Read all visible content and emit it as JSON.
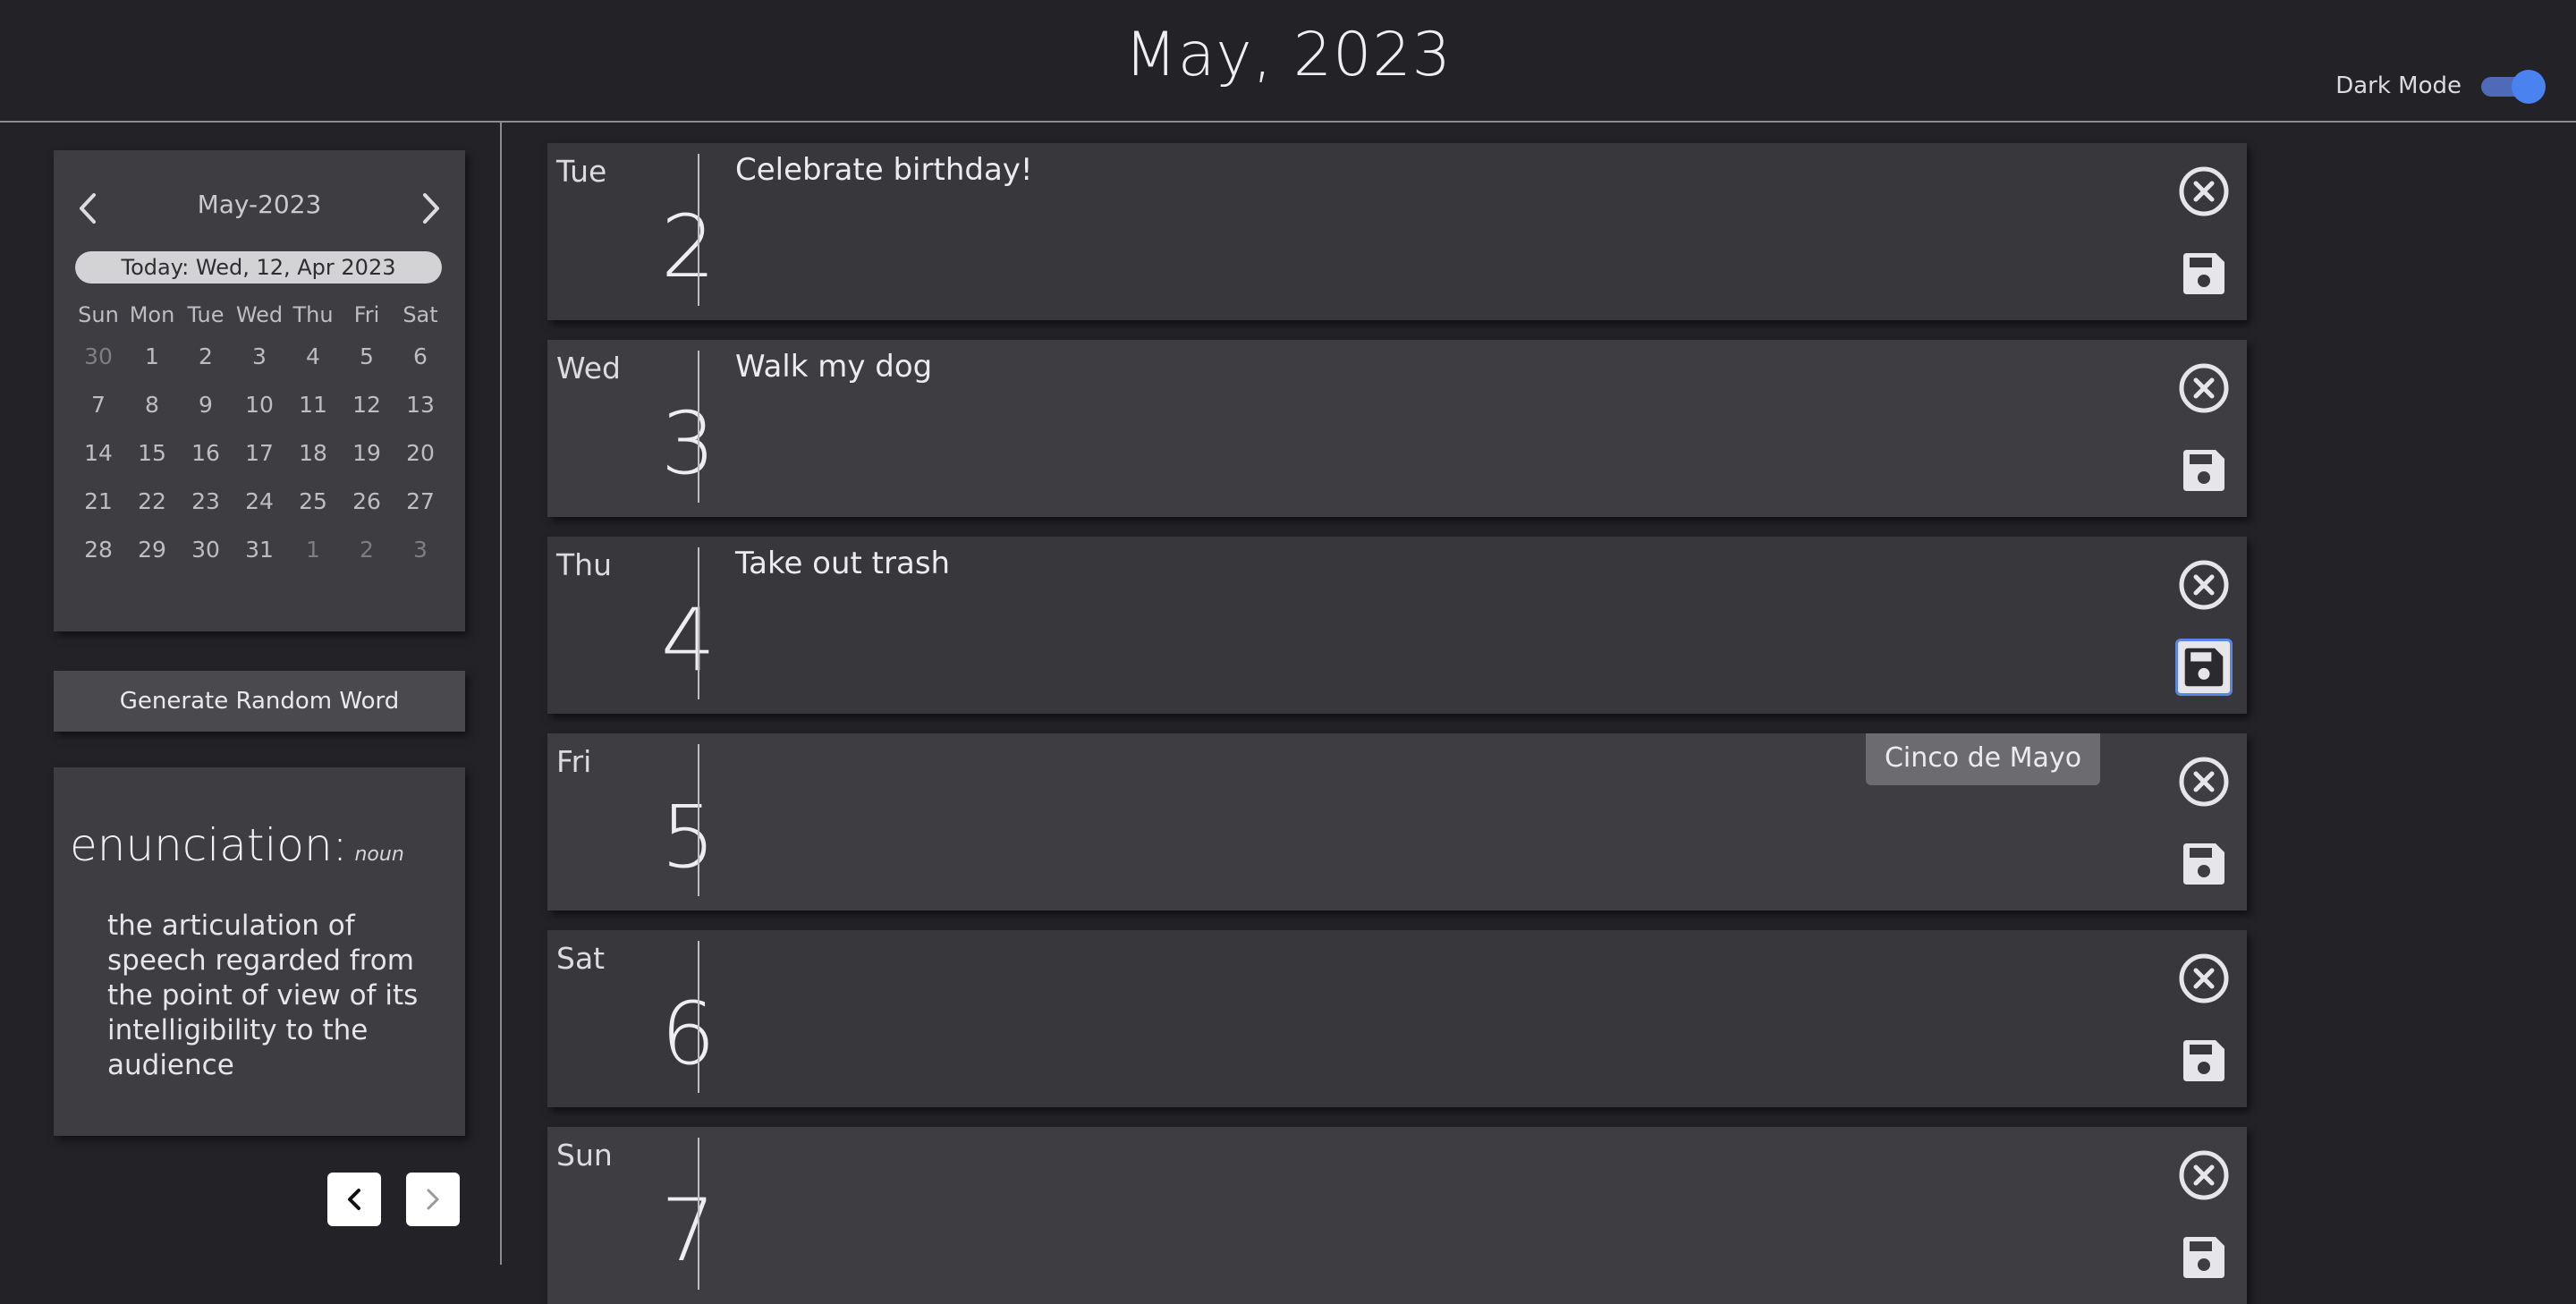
{
  "header": {
    "title": "May, 2023",
    "dark_mode_label": "Dark Mode",
    "dark_mode_on": true
  },
  "mini_calendar": {
    "month_label": "May-2023",
    "today_label": "Today: Wed, 12, Apr 2023",
    "weekdays": [
      "Sun",
      "Mon",
      "Tue",
      "Wed",
      "Thu",
      "Fri",
      "Sat"
    ],
    "weeks": [
      [
        "30",
        "1",
        "2",
        "3",
        "4",
        "5",
        "6"
      ],
      [
        "7",
        "8",
        "9",
        "10",
        "11",
        "12",
        "13"
      ],
      [
        "14",
        "15",
        "16",
        "17",
        "18",
        "19",
        "20"
      ],
      [
        "21",
        "22",
        "23",
        "24",
        "25",
        "26",
        "27"
      ],
      [
        "28",
        "29",
        "30",
        "31",
        "1",
        "2",
        "3"
      ]
    ]
  },
  "generate_button_label": "Generate Random Word",
  "word": {
    "term": "enunciation:",
    "part_of_speech": "noun",
    "definition": "the articulation of speech regarded from the point of view of its intelligibility to the audience"
  },
  "days": [
    {
      "weekday": "Tue",
      "number": "2",
      "note": "Celebrate birthday!",
      "holiday": ""
    },
    {
      "weekday": "Wed",
      "number": "3",
      "note": "Walk my dog",
      "holiday": ""
    },
    {
      "weekday": "Thu",
      "number": "4",
      "note": "Take out trash",
      "holiday": ""
    },
    {
      "weekday": "Fri",
      "number": "5",
      "note": "",
      "holiday": "Cinco de Mayo"
    },
    {
      "weekday": "Sat",
      "number": "6",
      "note": "",
      "holiday": ""
    },
    {
      "weekday": "Sun",
      "number": "7",
      "note": "",
      "holiday": ""
    }
  ],
  "colors": {
    "background": "#232226",
    "panel": "#3e3d42",
    "accent": "#4a82f0"
  }
}
